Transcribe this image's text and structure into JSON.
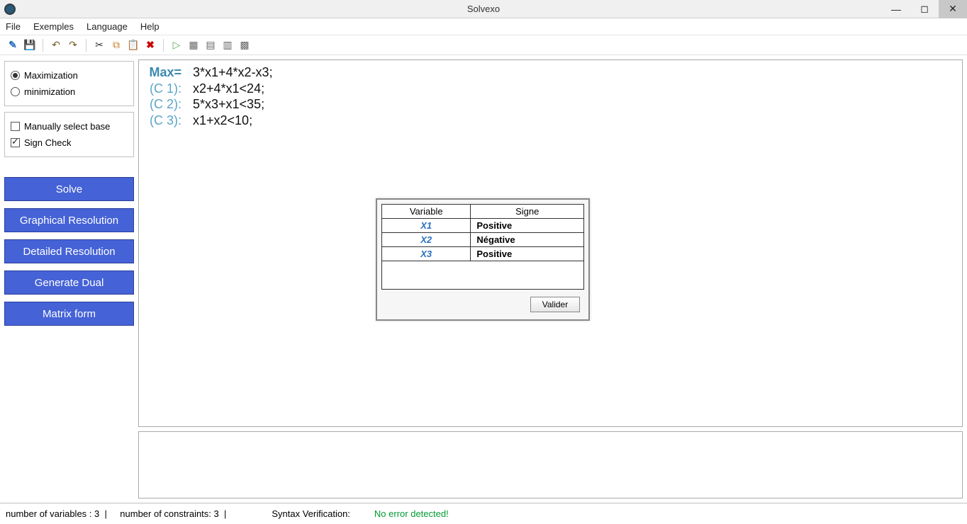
{
  "title": "Solvexo",
  "menus": [
    "File",
    "Exemples",
    "Language",
    "Help"
  ],
  "sidebar": {
    "opt_max": "Maximization",
    "opt_min": "minimization",
    "manual_base": "Manually select base",
    "sign_check": "Sign Check",
    "buttons": {
      "solve": "Solve",
      "graphical": "Graphical Resolution",
      "detailed": "Detailed Resolution",
      "dual": "Generate Dual",
      "matrix": "Matrix form"
    }
  },
  "editor": {
    "lines": [
      {
        "label": "Max=",
        "expr": "3*x1+4*x2-x3;"
      },
      {
        "label": "(C 1):",
        "expr": "x2+4*x1<24;"
      },
      {
        "label": "(C 2):",
        "expr": "5*x3+x1<35;"
      },
      {
        "label": "(C 3):",
        "expr": "x1+x2<10;"
      }
    ]
  },
  "dialog": {
    "headers": {
      "var": "Variable",
      "sign": "Signe"
    },
    "rows": [
      {
        "var": "X1",
        "sign": "Positive"
      },
      {
        "var": "X2",
        "sign": "Négative"
      },
      {
        "var": "X3",
        "sign": "Positive"
      }
    ],
    "valider": "Valider"
  },
  "status": {
    "vars": "number of variables : 3  |",
    "constraints": "    number of constraints: 3  |",
    "syntax_label": "Syntax Verification:",
    "syntax_msg": "No error detected!"
  },
  "icons": {
    "new": "new-file-icon",
    "save": "floppy-icon",
    "undo": "undo-icon",
    "redo": "redo-icon",
    "cut": "scissors-icon",
    "copy": "copy-icon",
    "paste": "paste-icon",
    "delete": "delete-x-icon",
    "run": "play-icon",
    "grid1": "grid-icon",
    "grid2": "table-icon",
    "grid3": "bars-icon",
    "grid4": "grid2-icon"
  }
}
